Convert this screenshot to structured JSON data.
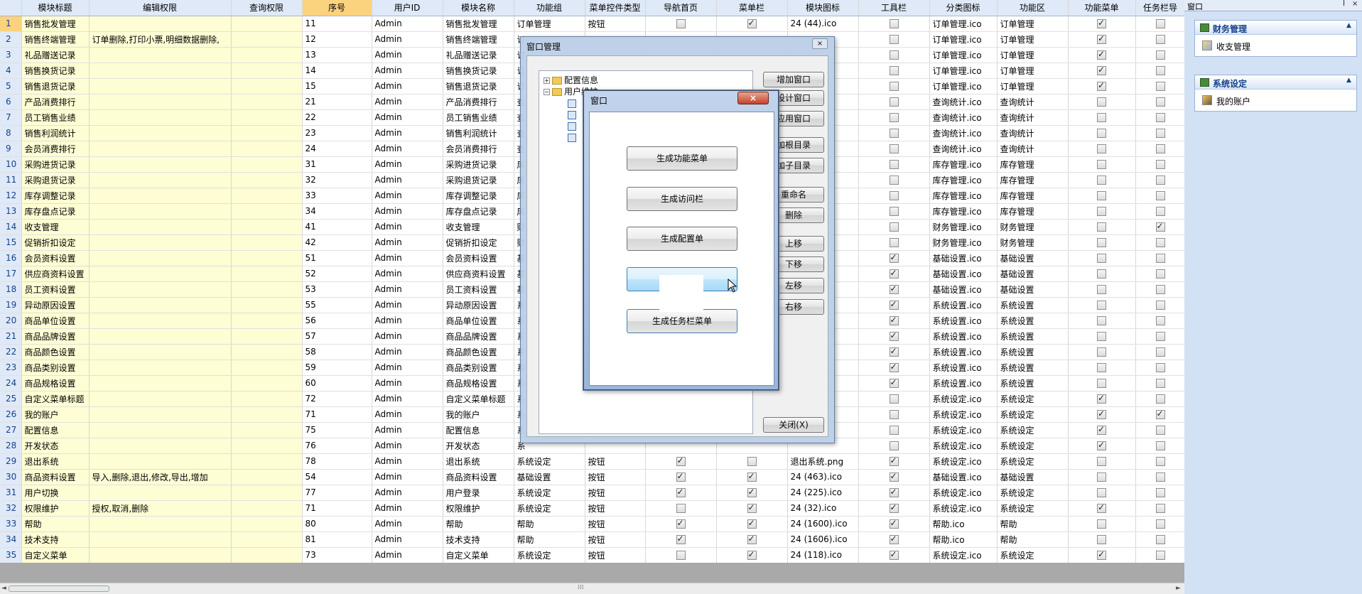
{
  "columns": [
    "",
    "模块标题",
    "编辑权限",
    "查询权限",
    "序号",
    "用户ID",
    "模块名称",
    "功能组",
    "菜单控件类型",
    "导航首页",
    "菜单栏",
    "模块图标",
    "工具栏",
    "分类图标",
    "功能区",
    "功能菜单",
    "任务栏导"
  ],
  "rows": [
    [
      "1",
      "销售批发管理",
      "",
      "",
      "11",
      "Admin",
      "销售批发管理",
      "订单管理",
      "按钮",
      false,
      true,
      "24 (44).ico",
      false,
      "订单管理.ico",
      "订单管理",
      true,
      false
    ],
    [
      "2",
      "销售终端管理",
      "订单删除,打印小票,明细数据删除,",
      "",
      "12",
      "Admin",
      "销售终端管理",
      "订",
      "",
      "",
      "",
      "",
      false,
      "订单管理.ico",
      "订单管理",
      true,
      false
    ],
    [
      "3",
      "礼品赠送记录",
      "",
      "",
      "13",
      "Admin",
      "礼品赠送记录",
      "订",
      "",
      "",
      "",
      "",
      false,
      "订单管理.ico",
      "订单管理",
      true,
      false
    ],
    [
      "4",
      "销售换货记录",
      "",
      "",
      "14",
      "Admin",
      "销售换货记录",
      "订",
      "",
      "",
      "",
      "",
      false,
      "订单管理.ico",
      "订单管理",
      true,
      false
    ],
    [
      "5",
      "销售退货记录",
      "",
      "",
      "15",
      "Admin",
      "销售退货记录",
      "订",
      "",
      "",
      "",
      "",
      false,
      "订单管理.ico",
      "订单管理",
      true,
      false
    ],
    [
      "6",
      "产品消费排行",
      "",
      "",
      "21",
      "Admin",
      "产品消费排行",
      "查",
      "",
      "",
      "",
      "",
      false,
      "查询统计.ico",
      "查询统计",
      false,
      false
    ],
    [
      "7",
      "员工销售业绩",
      "",
      "",
      "22",
      "Admin",
      "员工销售业绩",
      "查",
      "",
      "",
      "",
      "",
      false,
      "查询统计.ico",
      "查询统计",
      false,
      false
    ],
    [
      "8",
      "销售利润统计",
      "",
      "",
      "23",
      "Admin",
      "销售利润统计",
      "查",
      "",
      "",
      "",
      "",
      false,
      "查询统计.ico",
      "查询统计",
      false,
      false
    ],
    [
      "9",
      "会员消费排行",
      "",
      "",
      "24",
      "Admin",
      "会员消费排行",
      "查",
      "",
      "",
      "",
      "",
      false,
      "查询统计.ico",
      "查询统计",
      false,
      false
    ],
    [
      "10",
      "采购进货记录",
      "",
      "",
      "31",
      "Admin",
      "采购进货记录",
      "库",
      "",
      "",
      "",
      "",
      false,
      "库存管理.ico",
      "库存管理",
      false,
      false
    ],
    [
      "11",
      "采购退货记录",
      "",
      "",
      "32",
      "Admin",
      "采购退货记录",
      "库",
      "",
      "",
      "",
      "",
      false,
      "库存管理.ico",
      "库存管理",
      false,
      false
    ],
    [
      "12",
      "库存调整记录",
      "",
      "",
      "33",
      "Admin",
      "库存调整记录",
      "库",
      "",
      "",
      "",
      "",
      false,
      "库存管理.ico",
      "库存管理",
      false,
      false
    ],
    [
      "13",
      "库存盘点记录",
      "",
      "",
      "34",
      "Admin",
      "库存盘点记录",
      "库",
      "",
      "",
      "",
      "",
      false,
      "库存管理.ico",
      "库存管理",
      false,
      false
    ],
    [
      "14",
      "收支管理",
      "",
      "",
      "41",
      "Admin",
      "收支管理",
      "财",
      "",
      "",
      "",
      "",
      false,
      "财务管理.ico",
      "财务管理",
      false,
      true
    ],
    [
      "15",
      "促销折扣设定",
      "",
      "",
      "42",
      "Admin",
      "促销折扣设定",
      "财",
      "",
      "",
      "",
      "",
      false,
      "财务管理.ico",
      "财务管理",
      false,
      false
    ],
    [
      "16",
      "会员资料设置",
      "",
      "",
      "51",
      "Admin",
      "会员资料设置",
      "基",
      "",
      "",
      "",
      "",
      true,
      "基础设置.ico",
      "基础设置",
      false,
      false
    ],
    [
      "17",
      "供应商资料设置",
      "",
      "",
      "52",
      "Admin",
      "供应商资料设置",
      "基",
      "",
      "",
      "",
      "",
      true,
      "基础设置.ico",
      "基础设置",
      false,
      false
    ],
    [
      "18",
      "员工资料设置",
      "",
      "",
      "53",
      "Admin",
      "员工资料设置",
      "基",
      "",
      "",
      "",
      "",
      true,
      "基础设置.ico",
      "基础设置",
      false,
      false
    ],
    [
      "19",
      "异动原因设置",
      "",
      "",
      "55",
      "Admin",
      "异动原因设置",
      "系",
      "",
      "",
      "",
      "",
      true,
      "系统设置.ico",
      "系统设置",
      false,
      false
    ],
    [
      "20",
      "商品单位设置",
      "",
      "",
      "56",
      "Admin",
      "商品单位设置",
      "系",
      "",
      "",
      "",
      "",
      true,
      "系统设置.ico",
      "系统设置",
      false,
      false
    ],
    [
      "21",
      "商品品牌设置",
      "",
      "",
      "57",
      "Admin",
      "商品品牌设置",
      "系",
      "",
      "",
      "",
      "",
      true,
      "系统设置.ico",
      "系统设置",
      false,
      false
    ],
    [
      "22",
      "商品颜色设置",
      "",
      "",
      "58",
      "Admin",
      "商品颜色设置",
      "系",
      "",
      "",
      "",
      "",
      true,
      "系统设置.ico",
      "系统设置",
      false,
      false
    ],
    [
      "23",
      "商品类别设置",
      "",
      "",
      "59",
      "Admin",
      "商品类别设置",
      "系",
      "",
      "",
      "",
      "",
      true,
      "系统设置.ico",
      "系统设置",
      false,
      false
    ],
    [
      "24",
      "商品规格设置",
      "",
      "",
      "60",
      "Admin",
      "商品规格设置",
      "系",
      "",
      "",
      "",
      "",
      true,
      "系统设置.ico",
      "系统设置",
      false,
      false
    ],
    [
      "25",
      "自定义菜单标题",
      "",
      "",
      "72",
      "Admin",
      "自定义菜单标题",
      "系",
      "",
      "",
      "",
      "",
      false,
      "系统设定.ico",
      "系统设定",
      true,
      false
    ],
    [
      "26",
      "我的账户",
      "",
      "",
      "71",
      "Admin",
      "我的账户",
      "系",
      "",
      "",
      "",
      "",
      false,
      "系统设定.ico",
      "系统设定",
      true,
      true
    ],
    [
      "27",
      "配置信息",
      "",
      "",
      "75",
      "Admin",
      "配置信息",
      "系",
      "",
      "",
      "",
      "",
      false,
      "系统设定.ico",
      "系统设定",
      true,
      false
    ],
    [
      "28",
      "开发状态",
      "",
      "",
      "76",
      "Admin",
      "开发状态",
      "系",
      "",
      "",
      "",
      "",
      false,
      "系统设定.ico",
      "系统设定",
      true,
      false
    ],
    [
      "29",
      "退出系统",
      "",
      "",
      "78",
      "Admin",
      "退出系统",
      "系统设定",
      "按钮",
      true,
      false,
      "退出系统.png",
      true,
      "系统设定.ico",
      "系统设定",
      false,
      false
    ],
    [
      "30",
      "商品资料设置",
      "导入,删除,退出,修改,导出,增加",
      "",
      "54",
      "Admin",
      "商品资料设置",
      "基础设置",
      "按钮",
      true,
      true,
      "24 (463).ico",
      true,
      "基础设置.ico",
      "基础设置",
      false,
      false
    ],
    [
      "31",
      "用户切换",
      "",
      "",
      "77",
      "Admin",
      "用户登录",
      "系统设定",
      "按钮",
      true,
      true,
      "24 (225).ico",
      true,
      "系统设定.ico",
      "系统设定",
      false,
      false
    ],
    [
      "32",
      "权限维护",
      "授权,取消,删除",
      "",
      "71",
      "Admin",
      "权限维护",
      "系统设定",
      "按钮",
      false,
      true,
      "24 (32).ico",
      true,
      "系统设定.ico",
      "系统设定",
      true,
      false
    ],
    [
      "33",
      "帮助",
      "",
      "",
      "80",
      "Admin",
      "帮助",
      "帮助",
      "按钮",
      true,
      true,
      "24 (1600).ico",
      true,
      "帮助.ico",
      "帮助",
      false,
      false
    ],
    [
      "34",
      "技术支持",
      "",
      "",
      "81",
      "Admin",
      "技术支持",
      "帮助",
      "按钮",
      true,
      true,
      "24 (1606).ico",
      true,
      "帮助.ico",
      "帮助",
      false,
      false
    ],
    [
      "35",
      "自定义菜单",
      "",
      "",
      "73",
      "Admin",
      "自定义菜单",
      "系统设定",
      "按钮",
      false,
      true,
      "24 (118).ico",
      true,
      "系统设定.ico",
      "系统设定",
      true,
      false
    ]
  ],
  "right_panel": {
    "title": "窗口",
    "pin_icon": "pin-icon",
    "groups": [
      {
        "title": "财务管理",
        "items": [
          "收支管理"
        ]
      },
      {
        "title": "系统设定",
        "items": [
          "我的账户"
        ]
      }
    ]
  },
  "window_manager": {
    "title": "窗口管理",
    "close_glyph": "×",
    "tree": [
      {
        "label": "配置信息",
        "expander": "+"
      },
      {
        "label": "用户维护",
        "expander": "−"
      }
    ],
    "buttons": [
      "增加窗口",
      "设计窗口",
      "应用窗口",
      "加根目录",
      "加子目录",
      "重命名",
      "删除",
      "上移",
      "下移",
      "左移",
      "右移"
    ],
    "close_button": "关闭(X)"
  },
  "child_window": {
    "title": "窗口",
    "close_glyph": "×",
    "buttons": [
      "生成功能菜单",
      "生成访问栏",
      "生成配置单",
      "",
      "生成任务栏菜单"
    ]
  }
}
